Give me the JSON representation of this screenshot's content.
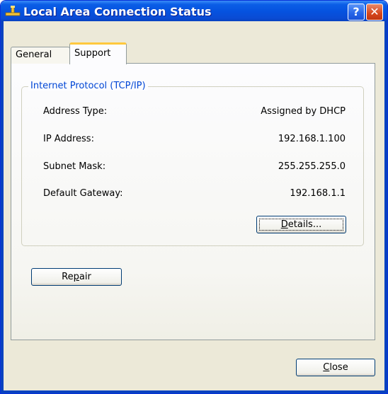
{
  "window": {
    "title": "Local Area Connection Status",
    "help_label": "?",
    "close_label": "✕"
  },
  "tabs": [
    {
      "label": "General",
      "selected": false
    },
    {
      "label": "Support",
      "selected": true
    }
  ],
  "group": {
    "title": "Internet Protocol (TCP/IP)",
    "rows": [
      {
        "label": "Address Type:",
        "value": "Assigned by DHCP"
      },
      {
        "label": "IP Address:",
        "value": "192.168.1.100"
      },
      {
        "label": "Subnet Mask:",
        "value": "255.255.255.0"
      },
      {
        "label": "Default Gateway:",
        "value": "192.168.1.1"
      }
    ],
    "details_button": {
      "pre": "",
      "accel": "D",
      "post": "etails..."
    }
  },
  "repair_button": {
    "pre": "Re",
    "accel": "p",
    "post": "air"
  },
  "close_button": {
    "pre": "",
    "accel": "C",
    "post": "lose"
  },
  "colors": {
    "titlebar": "#0553e0",
    "frame": "#0842c0",
    "tab_accent": "#ffc83d",
    "group_title": "#0046d5",
    "close_red": "#d6461c"
  }
}
